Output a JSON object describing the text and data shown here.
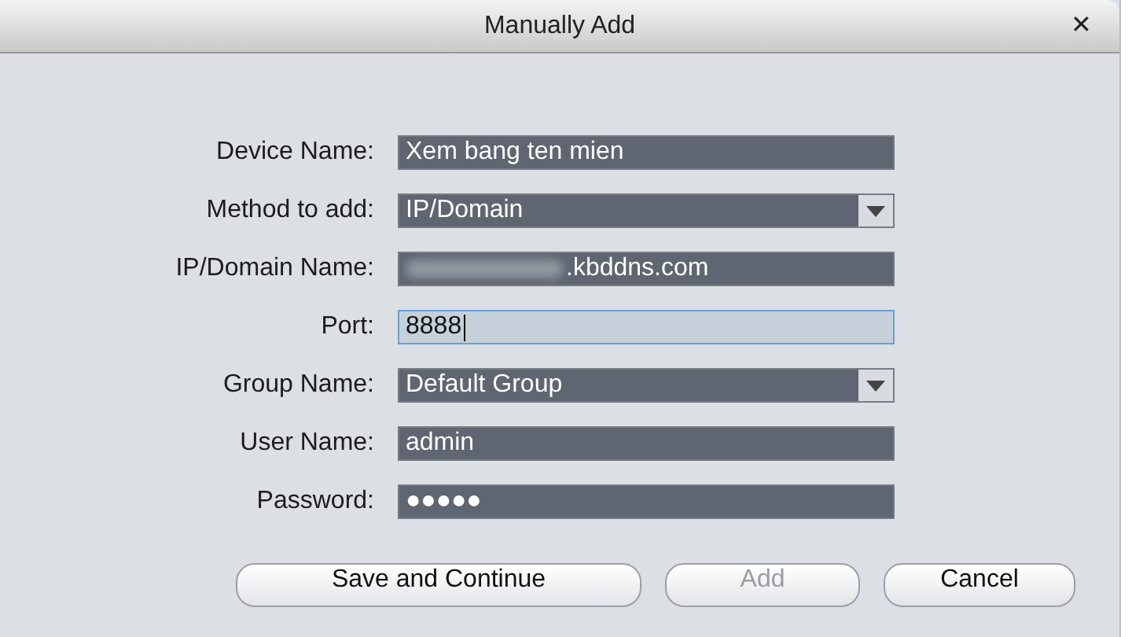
{
  "window": {
    "title": "Manually Add",
    "close": "✕"
  },
  "fields": [
    {
      "label": "Device Name:",
      "kind": "text",
      "value": "Xem bang ten mien",
      "focused": false
    },
    {
      "label": "Method to add:",
      "kind": "dropdown",
      "value": "IP/Domain",
      "focused": false
    },
    {
      "label": "IP/Domain Name:",
      "kind": "redacted",
      "value": ".kbddns.com",
      "focused": false
    },
    {
      "label": "Port:",
      "kind": "text",
      "value": "8888",
      "focused": true
    },
    {
      "label": "Group Name:",
      "kind": "dropdown",
      "value": "Default Group",
      "focused": false
    },
    {
      "label": "User Name:",
      "kind": "text",
      "value": "admin",
      "focused": false
    },
    {
      "label": "Password:",
      "kind": "password",
      "value": "●●●●●",
      "focused": false
    }
  ],
  "buttons": [
    {
      "label": "Save and Continue",
      "disabled": false
    },
    {
      "label": "Add",
      "disabled": true
    },
    {
      "label": "Cancel",
      "disabled": false
    }
  ]
}
